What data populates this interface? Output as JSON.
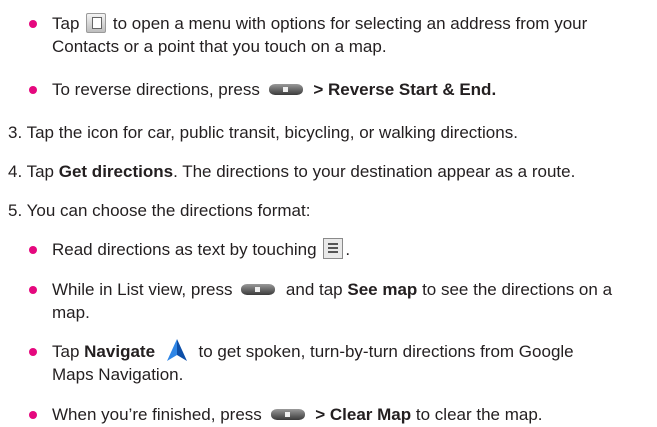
{
  "lines": {
    "b1_a": "Tap",
    "b1_b": "to open a menu with options for selecting an address from your",
    "b1_c": "Contacts or a point that you touch on a map.",
    "b2_a": "To reverse directions, press",
    "b2_b": "> Reverse Start & End.",
    "s3": "3. Tap the icon for car, public transit, bicycling, or walking directions.",
    "s4_a": "4. Tap",
    "s4_b": "Get directions",
    "s4_c": ". The directions to your destination appear as a route.",
    "s5": "5. You can choose the directions format:",
    "b3_a": "Read directions as text by touching",
    "b3_b": ".",
    "b4_a": "While in List view, press",
    "b4_b": "and tap",
    "b4_c": "See map",
    "b4_d": "to see the directions on a",
    "b4_e": "map.",
    "b5_a": "Tap",
    "b5_b": "Navigate",
    "b5_c": "to get spoken, turn-by-turn directions from Google",
    "b5_d": "Maps Navigation.",
    "b6_a": "When you’re finished, press",
    "b6_b": "> Clear Map",
    "b6_c": "to clear the map."
  },
  "colors": {
    "bullet": "#e5087e",
    "text": "#231f20",
    "nav_icon": "#1e6fd1"
  },
  "icons": [
    "contacts-icon",
    "menu-key-icon",
    "list-view-icon",
    "navigate-arrow-icon"
  ]
}
